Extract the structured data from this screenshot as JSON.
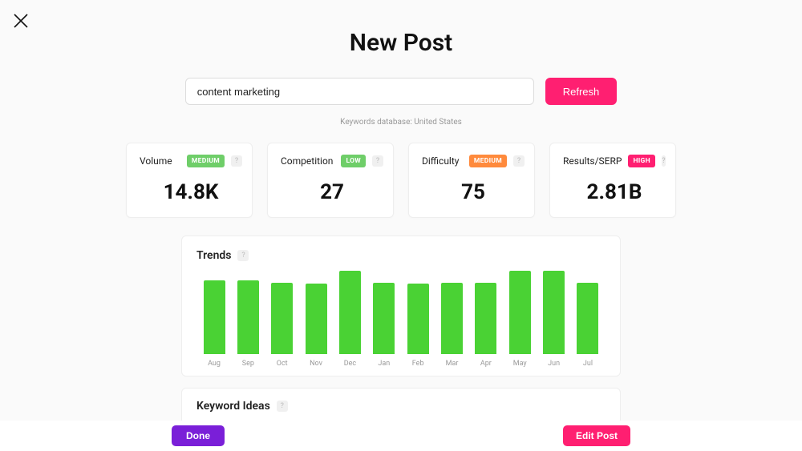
{
  "header": {
    "title": "New Post"
  },
  "search": {
    "value": "content marketing",
    "refresh_label": "Refresh"
  },
  "db_note": "Keywords database: United States",
  "metrics": {
    "volume": {
      "label": "Volume",
      "badge": "MEDIUM",
      "value": "14.8K"
    },
    "competition": {
      "label": "Competition",
      "badge": "LOW",
      "value": "27"
    },
    "difficulty": {
      "label": "Difficulty",
      "badge": "MEDIUM",
      "value": "75"
    },
    "results": {
      "label": "Results/SERP",
      "badge": "HIGH",
      "value": "2.81B"
    }
  },
  "trends_title": "Trends",
  "ideas_title": "Keyword Ideas",
  "footer": {
    "done": "Done",
    "edit": "Edit Post"
  },
  "chart_data": {
    "type": "bar",
    "categories": [
      "Aug",
      "Sep",
      "Oct",
      "Nov",
      "Dec",
      "Jan",
      "Feb",
      "Mar",
      "Apr",
      "May",
      "Jun",
      "Jul"
    ],
    "values": [
      88,
      88,
      86,
      85,
      100,
      86,
      85,
      86,
      86,
      100,
      100,
      86
    ],
    "title": "Trends",
    "xlabel": "",
    "ylabel": "",
    "ylim": [
      0,
      100
    ]
  }
}
